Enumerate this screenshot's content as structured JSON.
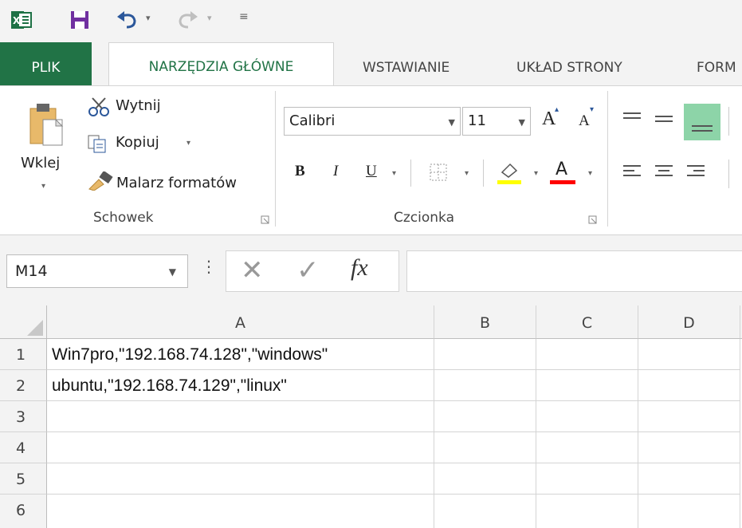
{
  "quick_access": {
    "excel_icon": "excel-app-icon",
    "save_icon": "save-icon",
    "undo_icon": "undo-icon",
    "redo_icon": "redo-icon",
    "customize_icon": "customize-qat-icon"
  },
  "tabs": [
    {
      "label": "PLIK"
    },
    {
      "label": "NARZĘDZIA GŁÓWNE"
    },
    {
      "label": "WSTAWIANIE"
    },
    {
      "label": "UKŁAD STRONY"
    },
    {
      "label": "FORM"
    }
  ],
  "clipboard": {
    "paste_label": "Wklej",
    "cut_label": "Wytnij",
    "copy_label": "Kopiuj",
    "format_painter_label": "Malarz formatów",
    "group_label": "Schowek"
  },
  "font": {
    "font_name": "Calibri",
    "font_size": "11",
    "bold": "B",
    "italic": "I",
    "underline": "U",
    "grow": "A",
    "shrink": "A",
    "font_color_letter": "A",
    "group_label": "Czcionka",
    "highlight_color": "#ffff00",
    "font_color": "#ff0000"
  },
  "formula_bar": {
    "name_box": "M14",
    "colon": "⋮",
    "cancel": "✕",
    "enter": "✓",
    "fx": "fx",
    "value": ""
  },
  "grid": {
    "columns": [
      "A",
      "B",
      "C",
      "D"
    ],
    "rows": [
      {
        "num": "1",
        "a": "Win7pro,\"192.168.74.128\",\"windows\""
      },
      {
        "num": "2",
        "a": "ubuntu,\"192.168.74.129\",\"linux\""
      },
      {
        "num": "3",
        "a": ""
      },
      {
        "num": "4",
        "a": ""
      },
      {
        "num": "5",
        "a": ""
      },
      {
        "num": "6",
        "a": ""
      }
    ]
  },
  "colors": {
    "accent": "#217346",
    "ribbon_bg": "#f3f3f3"
  }
}
